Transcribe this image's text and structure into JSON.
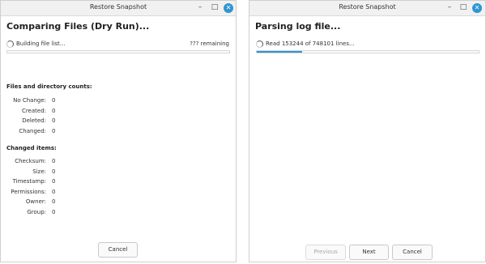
{
  "window_title": "Restore Snapshot",
  "titlebar_icons": {
    "minimize": "–",
    "maximize": "□",
    "close": "✕"
  },
  "accent_color": "#2e95d3",
  "left": {
    "heading": "Comparing Files (Dry Run)...",
    "status": "Building file list...",
    "remaining": "??? remaining",
    "progress": 0,
    "section_counts": "Files and directory counts:",
    "counts": [
      {
        "label": "No Change:",
        "value": "0"
      },
      {
        "label": "Created:",
        "value": "0"
      },
      {
        "label": "Deleted:",
        "value": "0"
      },
      {
        "label": "Changed:",
        "value": "0"
      }
    ],
    "section_changed": "Changed items:",
    "changed": [
      {
        "label": "Checksum:",
        "value": "0"
      },
      {
        "label": "Size:",
        "value": "0"
      },
      {
        "label": "Timestamp:",
        "value": "0"
      },
      {
        "label": "Permissions:",
        "value": "0"
      },
      {
        "label": "Owner:",
        "value": "0"
      },
      {
        "label": "Group:",
        "value": "0"
      }
    ],
    "cancel_label": "Cancel"
  },
  "right": {
    "heading": "Parsing log file...",
    "status": "Read 153244 of 748101 lines...",
    "progress_fraction": 0.2048,
    "previous_label": "Previous",
    "next_label": "Next",
    "cancel_label": "Cancel"
  }
}
